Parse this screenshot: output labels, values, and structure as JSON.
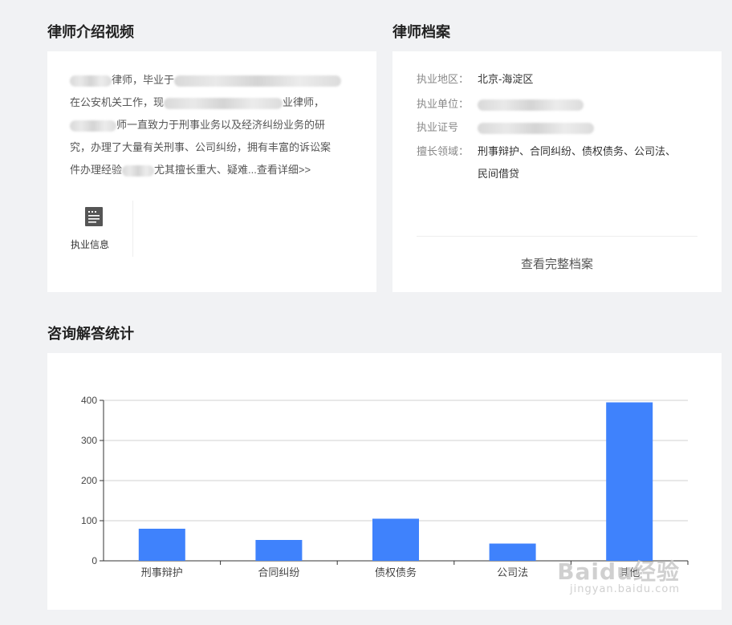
{
  "intro": {
    "title": "律师介绍视频",
    "line1_a": "律师，毕业于",
    "line2_a": "在公安机关工作，现",
    "line2_b": "业律师，",
    "line3_a": "师一直致力于刑事业务以及经济纠纷业务的研",
    "line4": "究，办理了大量有关刑事、公司纠纷，拥有丰富的诉讼案",
    "line5_a": "件办理经验",
    "line5_b": "尤其擅长重大、疑难...",
    "more": "查看详细>>",
    "info_label": "执业信息"
  },
  "profile": {
    "title": "律师档案",
    "region_label": "执业地区：",
    "region_value": "北京-海淀区",
    "unit_label": "执业单位：",
    "license_label": "执业证号",
    "fields_label": "擅长领域：",
    "fields_line1": "刑事辩护、合同纠纷、债权债务、公司法、",
    "fields_line2": "民间借贷",
    "full_link": "查看完整档案"
  },
  "stats": {
    "title": "咨询解答统计"
  },
  "chart_data": {
    "type": "bar",
    "categories": [
      "刑事辩护",
      "合同纠纷",
      "债权债务",
      "公司法",
      "其他"
    ],
    "values": [
      80,
      52,
      105,
      43,
      395
    ],
    "ylim": [
      0,
      400
    ],
    "yticks": [
      0,
      100,
      200,
      300,
      400
    ],
    "grid": true,
    "bar_color": "#3f82fc"
  },
  "watermark": {
    "main": "Baidu经验",
    "sub": "jingyan.baidu.com"
  }
}
